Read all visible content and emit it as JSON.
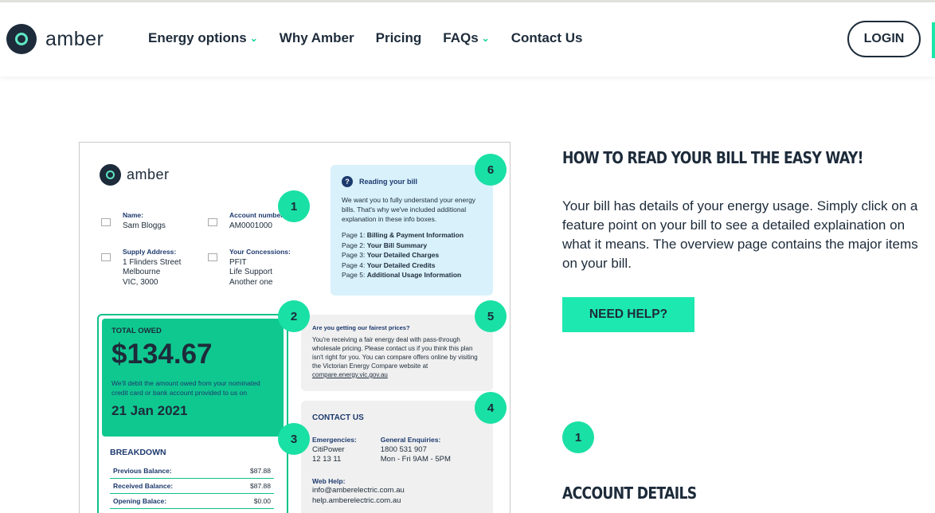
{
  "brand": {
    "name": "amber"
  },
  "nav": {
    "items": [
      {
        "label": "Energy options",
        "dropdown": true
      },
      {
        "label": "Why Amber",
        "dropdown": false
      },
      {
        "label": "Pricing",
        "dropdown": false
      },
      {
        "label": "FAQs",
        "dropdown": true
      },
      {
        "label": "Contact Us",
        "dropdown": false
      }
    ],
    "login_label": "LOGIN"
  },
  "bill": {
    "brand": "amber",
    "name_label": "Name:",
    "name_value": "Sam Bloggs",
    "account_label": "Account number",
    "account_value": "AM0001000",
    "supply_label": "Supply Address:",
    "supply_lines": [
      "1 Flinders Street",
      "Melbourne",
      "VIC, 3000"
    ],
    "concessions_label": "Your Concessions:",
    "concession_lines": [
      "PFIT",
      "Life Support",
      "Another one"
    ],
    "info": {
      "title": "Reading your bill",
      "text": "We want you to fully understand your energy bills. That's why we've included additional explanation in these info boxes.",
      "pages": [
        {
          "page": "Page 1:",
          "name": "Billing & Payment Information"
        },
        {
          "page": "Page 2:",
          "name": "Your Bill Summary"
        },
        {
          "page": "Page 3:",
          "name": "Your Detailed Charges"
        },
        {
          "page": "Page 4:",
          "name": "Your Detailed Credits"
        },
        {
          "page": "Page 5:",
          "name": "Additional Usage Information"
        }
      ]
    },
    "owed": {
      "label": "TOTAL OWED",
      "amount": "$134.67",
      "note": "We'll debit the amount owed from your nominated credit card or bank account provided to us on",
      "date": "21 Jan 2021"
    },
    "breakdown": {
      "title": "BREAKDOWN",
      "rows": [
        {
          "label": "Previous Balance:",
          "value": "$87.88"
        },
        {
          "label": "Received Balance:",
          "value": "$87.88"
        },
        {
          "label": "Opening Balace:",
          "value": "$0.00"
        }
      ]
    },
    "fair": {
      "title": "Are you getting our fairest prices?",
      "text": "You're receiving a fair energy deal with pass-through wholesale pricing. Please contact us if you think this plan isn't right for you. You can compare offers online by visiting the Victorian Energy Compare website at",
      "link": "compare.energy.vic.gov.au"
    },
    "contact": {
      "title": "CONTACT US",
      "emergencies_label": "Emergencies:",
      "emergencies_lines": [
        "CitiPower",
        "12 13 11"
      ],
      "enquiries_label": "General Enquiries:",
      "enquiries_lines": [
        "1800 531 907",
        "Mon - Fri 9AM - 5PM"
      ],
      "web_label": "Web Help:",
      "web_lines": [
        "info@amberelectric.com.au",
        "help.amberelectric.com.au"
      ]
    },
    "markers": [
      "1",
      "2",
      "3",
      "4",
      "5",
      "6"
    ]
  },
  "content": {
    "heading": "HOW TO READ YOUR BILL THE EASY WAY!",
    "paragraph": "Your bill has details of your energy usage. Simply click on a feature point on your bill to see a detailed explaination on what it means.  The overview page contains the major items on your bill.",
    "help_button": "NEED HELP?",
    "section_number": "1",
    "section_heading": "ACCOUNT DETAILS"
  }
}
